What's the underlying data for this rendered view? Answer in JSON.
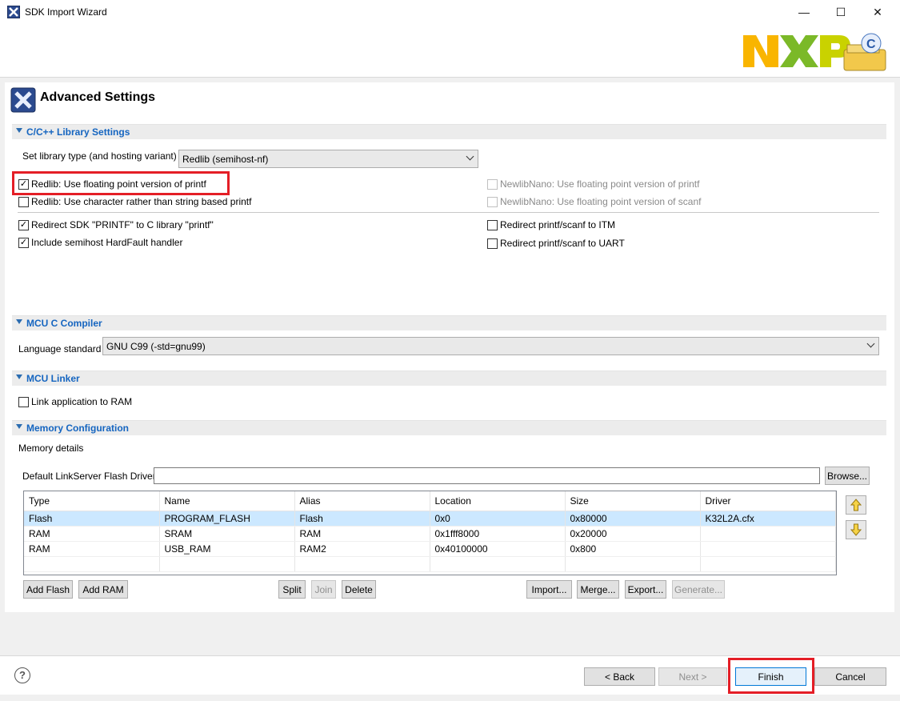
{
  "window": {
    "title": "SDK Import Wizard",
    "controls": {
      "minimize": "—",
      "maximize": "☐",
      "close": "✕"
    }
  },
  "header": {
    "title": "Advanced Settings",
    "logo_text": "NXP"
  },
  "library_section": {
    "title": "C/C++ Library Settings",
    "library_type_label": "Set library type (and hosting variant)",
    "library_type_value": "Redlib (semihost-nf)",
    "checkboxes_left": [
      {
        "label": "Redlib: Use floating point version of printf",
        "checked": true
      },
      {
        "label": "Redlib: Use character rather than string based printf",
        "checked": false
      }
    ],
    "checkboxes_right": [
      {
        "label": "NewlibNano: Use floating point version of printf",
        "checked": false
      },
      {
        "label": "NewlibNano: Use floating point version of scanf",
        "checked": false
      }
    ],
    "checkboxes_left_2": [
      {
        "label": "Redirect SDK \"PRINTF\" to C library \"printf\"",
        "checked": true
      },
      {
        "label": "Include semihost HardFault handler",
        "checked": true
      }
    ],
    "checkboxes_right_2": [
      {
        "label": "Redirect printf/scanf to ITM",
        "checked": false
      },
      {
        "label": "Redirect printf/scanf to UART",
        "checked": false
      }
    ]
  },
  "compiler_section": {
    "title": "MCU C Compiler",
    "language_label": "Language standard",
    "language_value": "GNU C99 (-std=gnu99)"
  },
  "linker_section": {
    "title": "MCU Linker",
    "link_ram_label": "Link application to RAM",
    "link_ram_checked": false
  },
  "memory_section": {
    "title": "Memory Configuration",
    "details_label": "Memory details",
    "flash_driver_label": "Default LinkServer Flash Driver",
    "flash_driver_value": "",
    "browse_label": "Browse...",
    "columns": [
      "Type",
      "Name",
      "Alias",
      "Location",
      "Size",
      "Driver"
    ],
    "rows": [
      [
        "Flash",
        "PROGRAM_FLASH",
        "Flash",
        "0x0",
        "0x80000",
        "K32L2A.cfx"
      ],
      [
        "RAM",
        "SRAM",
        "RAM",
        "0x1fff8000",
        "0x20000",
        ""
      ],
      [
        "RAM",
        "USB_RAM",
        "RAM2",
        "0x40100000",
        "0x800",
        ""
      ]
    ],
    "buttons": {
      "add_flash": "Add Flash",
      "add_ram": "Add RAM",
      "split": "Split",
      "join": "Join",
      "delete": "Delete",
      "import": "Import...",
      "merge": "Merge...",
      "export": "Export...",
      "generate": "Generate..."
    }
  },
  "footer": {
    "help": "?",
    "back": "< Back",
    "next": "Next >",
    "finish": "Finish",
    "cancel": "Cancel"
  },
  "colors": {
    "section_title": "#1565c0",
    "highlight": "#e41e26",
    "selection": "#cce8ff"
  }
}
